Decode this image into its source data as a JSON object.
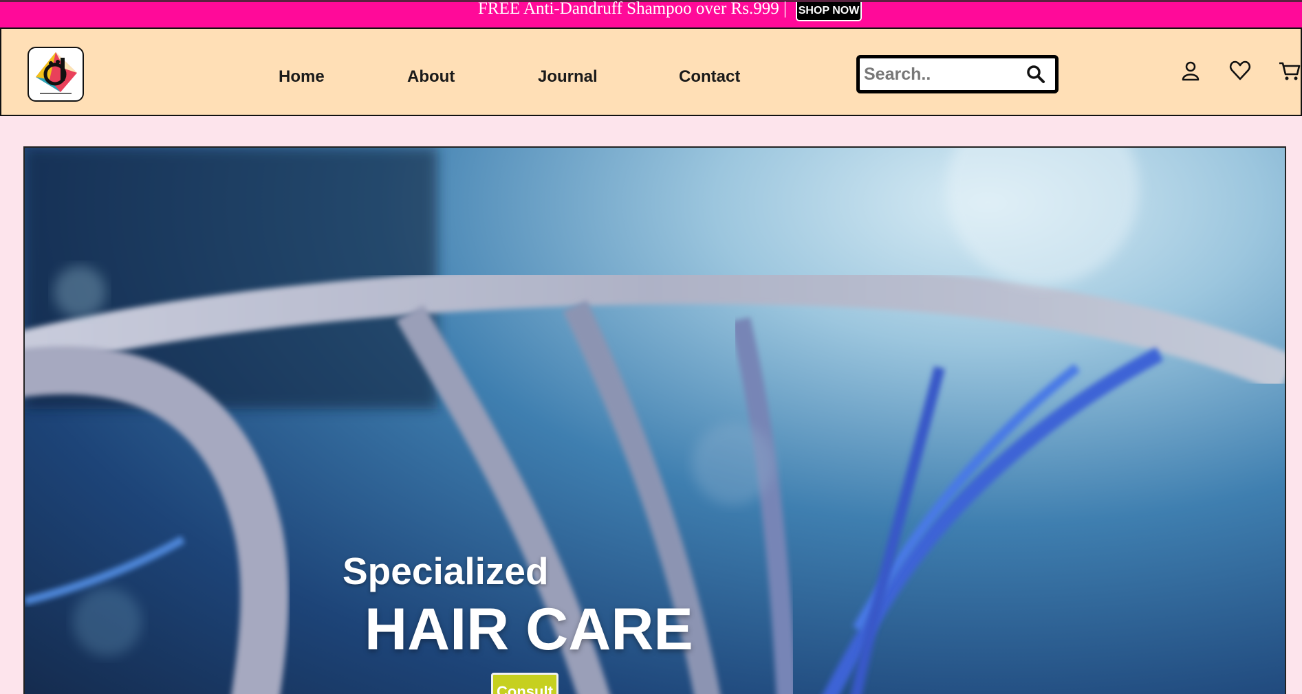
{
  "promo": {
    "text": "FREE Anti-Dandruff Shampoo over Rs.999 |",
    "button_label": "SHOP NOW"
  },
  "header": {
    "logo_icon": "brand-logo",
    "nav": [
      {
        "label": "Home"
      },
      {
        "label": "About"
      },
      {
        "label": "Journal"
      },
      {
        "label": "Contact"
      }
    ],
    "search": {
      "placeholder": "Search..",
      "value": "",
      "icon": "search-icon"
    },
    "icons": [
      "user-icon",
      "heart-icon",
      "cart-icon"
    ]
  },
  "hero": {
    "subtitle": "Specialized",
    "title": "HAIR CARE",
    "button_label": "Consult"
  },
  "colors": {
    "promo_bg": "#ff0a99",
    "header_bg": "#ffdfb6",
    "page_bg": "#fde4ec",
    "consult_bg": "#c6d01f"
  }
}
